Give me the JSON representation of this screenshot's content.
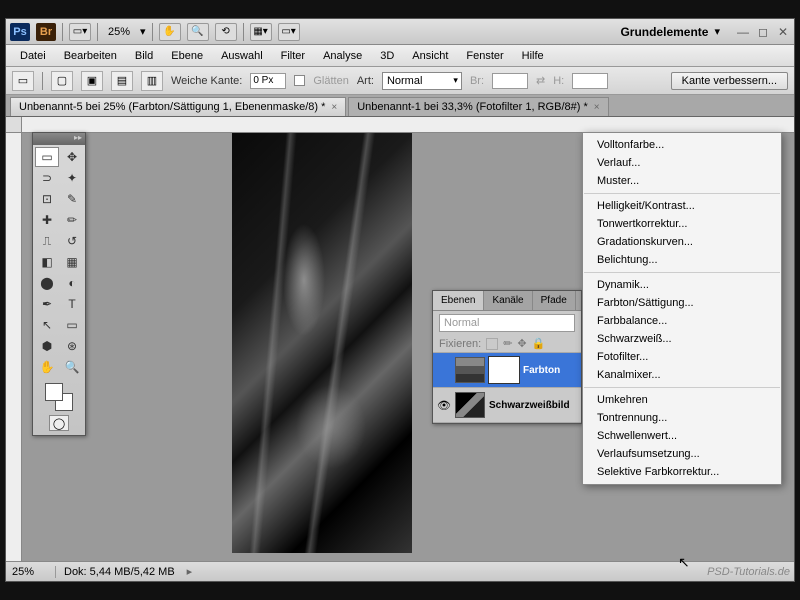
{
  "topbar": {
    "zoom": "25%",
    "workspace": "Grundelemente"
  },
  "menu": {
    "items": [
      "Datei",
      "Bearbeiten",
      "Bild",
      "Ebene",
      "Auswahl",
      "Filter",
      "Analyse",
      "3D",
      "Ansicht",
      "Fenster",
      "Hilfe"
    ]
  },
  "optbar": {
    "weiche_kante_lbl": "Weiche Kante:",
    "weiche_kante_val": "0 Px",
    "glaetten": "Glätten",
    "art_lbl": "Art:",
    "art_val": "Normal",
    "br_lbl": "Br:",
    "h_lbl": "H:",
    "refine": "Kante verbessern..."
  },
  "tabs": [
    "Unbenannt-5 bei 25% (Farbton/Sättigung 1, Ebenenmaske/8) *",
    "Unbenannt-1 bei 33,3% (Fotofilter 1, RGB/8#) *"
  ],
  "layers_panel": {
    "tabs": [
      "Ebenen",
      "Kanäle",
      "Pfade"
    ],
    "blend": "Normal",
    "lock_lbl": "Fixieren:",
    "layers": [
      {
        "name": "Farbton",
        "selected": true,
        "adjustment": true
      },
      {
        "name": "Schwarzweißbild",
        "selected": false,
        "adjustment": false
      }
    ]
  },
  "ctx_menu": {
    "g1": [
      "Volltonfarbe...",
      "Verlauf...",
      "Muster..."
    ],
    "g2": [
      "Helligkeit/Kontrast...",
      "Tonwertkorrektur...",
      "Gradationskurven...",
      "Belichtung..."
    ],
    "g3": [
      "Dynamik...",
      "Farbton/Sättigung...",
      "Farbbalance...",
      "Schwarzweiß...",
      "Fotofilter...",
      "Kanalmixer..."
    ],
    "g4": [
      "Umkehren",
      "Tontrennung...",
      "Schwellenwert...",
      "Verlaufsumsetzung...",
      "Selektive Farbkorrektur..."
    ]
  },
  "status": {
    "zoom": "25%",
    "doc": "Dok: 5,44 MB/5,42 MB"
  },
  "watermark": "PSD-Tutorials.de"
}
